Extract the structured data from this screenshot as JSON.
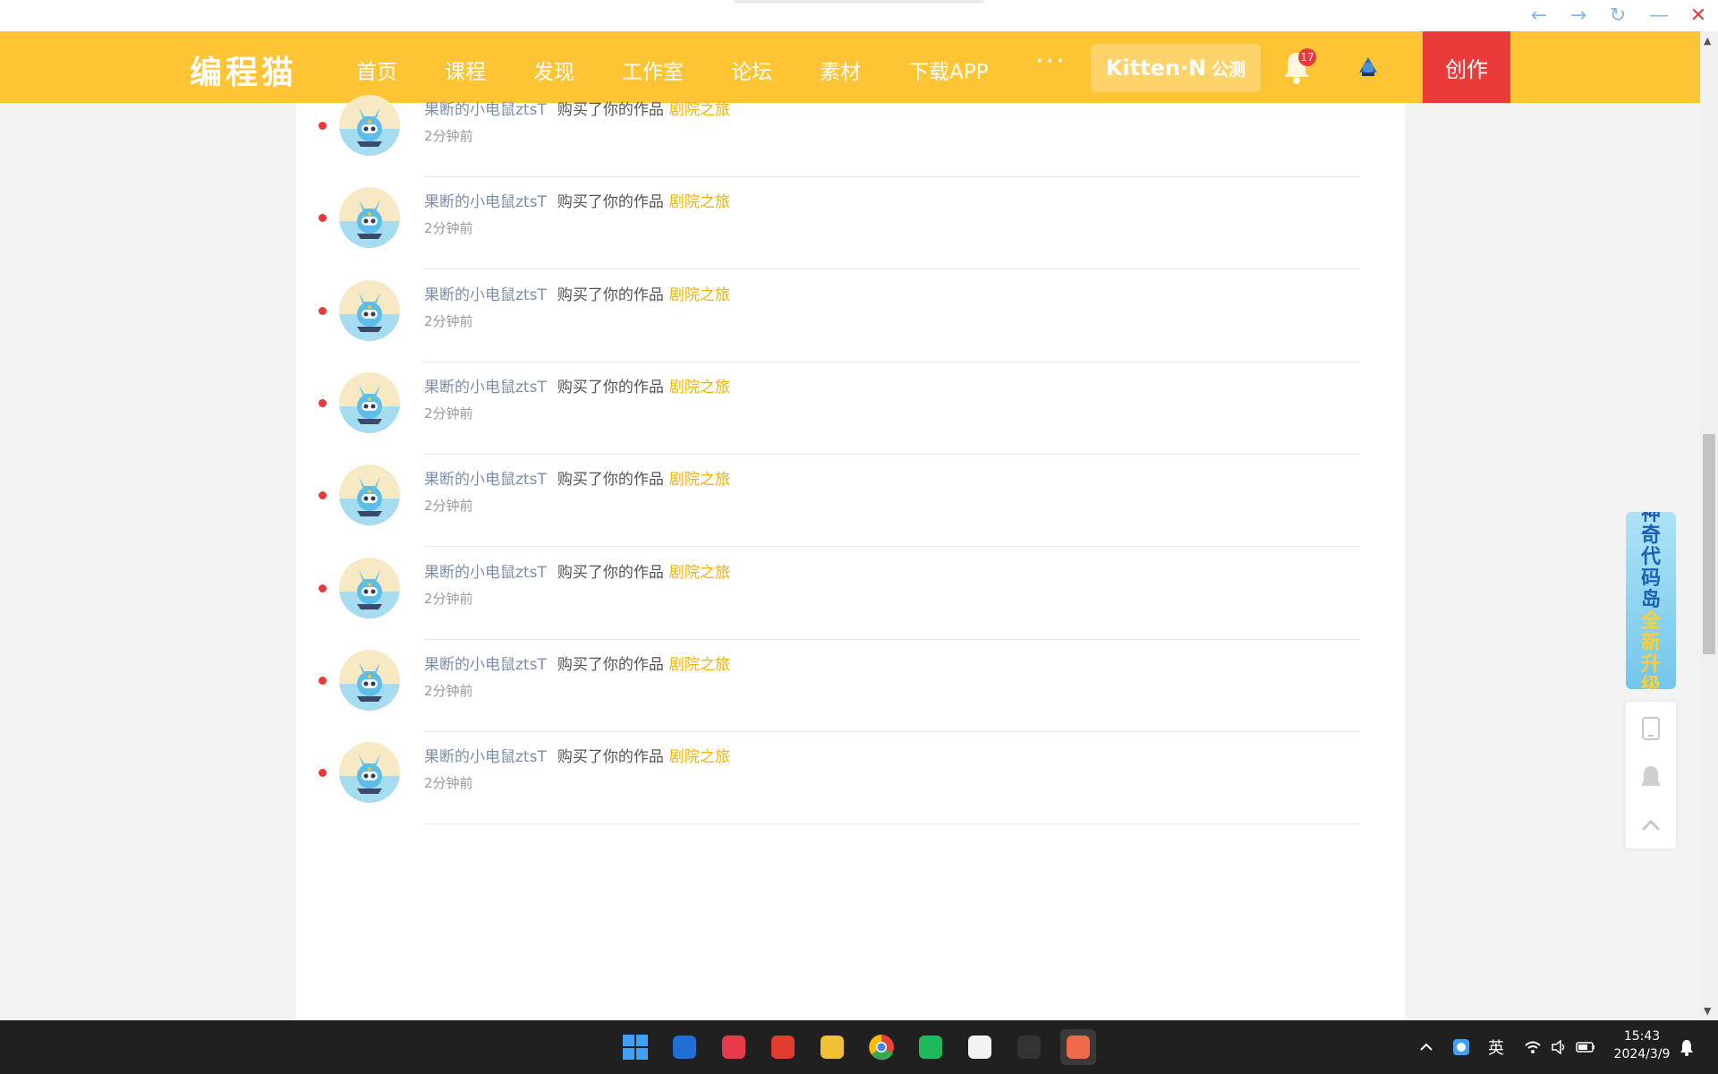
{
  "browser": {
    "back": "←",
    "forward": "→",
    "reload": "↻",
    "minimize": "—",
    "close": "✕"
  },
  "header": {
    "logo": "编程猫",
    "nav": [
      "首页",
      "课程",
      "发现",
      "工作室",
      "论坛",
      "素材",
      "下载APP"
    ],
    "more": "···",
    "kitten_label": "Kitten·N",
    "kitten_badge": "公测",
    "notification_count": "17",
    "create_label": "创作"
  },
  "messages": [
    {
      "user": "果断的小电鼠ztsT",
      "action": "购买了你的作品",
      "work": "剧院之旅",
      "time": "2分钟前",
      "unread": true
    },
    {
      "user": "果断的小电鼠ztsT",
      "action": "购买了你的作品",
      "work": "剧院之旅",
      "time": "2分钟前",
      "unread": true
    },
    {
      "user": "果断的小电鼠ztsT",
      "action": "购买了你的作品",
      "work": "剧院之旅",
      "time": "2分钟前",
      "unread": true
    },
    {
      "user": "果断的小电鼠ztsT",
      "action": "购买了你的作品",
      "work": "剧院之旅",
      "time": "2分钟前",
      "unread": true
    },
    {
      "user": "果断的小电鼠ztsT",
      "action": "购买了你的作品",
      "work": "剧院之旅",
      "time": "2分钟前",
      "unread": true
    },
    {
      "user": "果断的小电鼠ztsT",
      "action": "购买了你的作品",
      "work": "剧院之旅",
      "time": "2分钟前",
      "unread": true
    },
    {
      "user": "果断的小电鼠ztsT",
      "action": "购买了你的作品",
      "work": "剧院之旅",
      "time": "2分钟前",
      "unread": true
    },
    {
      "user": "果断的小电鼠ztsT",
      "action": "购买了你的作品",
      "work": "剧院之旅",
      "time": "2分钟前",
      "unread": true
    }
  ],
  "promo": {
    "line1": "神奇代码岛",
    "line2": "全新升级"
  },
  "taskbar": {
    "apps": [
      "windows-start-icon",
      "lenovo-icon",
      "netease-music-icon",
      "wps-icon",
      "file-explorer-icon",
      "chrome-icon",
      "wechat-icon",
      "microsoft-store-icon",
      "kwai-icon",
      "codemao-icon"
    ],
    "ime": "英",
    "time": "15:43",
    "date": "2024/3/9"
  },
  "colors": {
    "header": "#fec433",
    "create": "#ea3b3b",
    "work_link": "#f4b400",
    "user_link": "#7b8ea9"
  }
}
